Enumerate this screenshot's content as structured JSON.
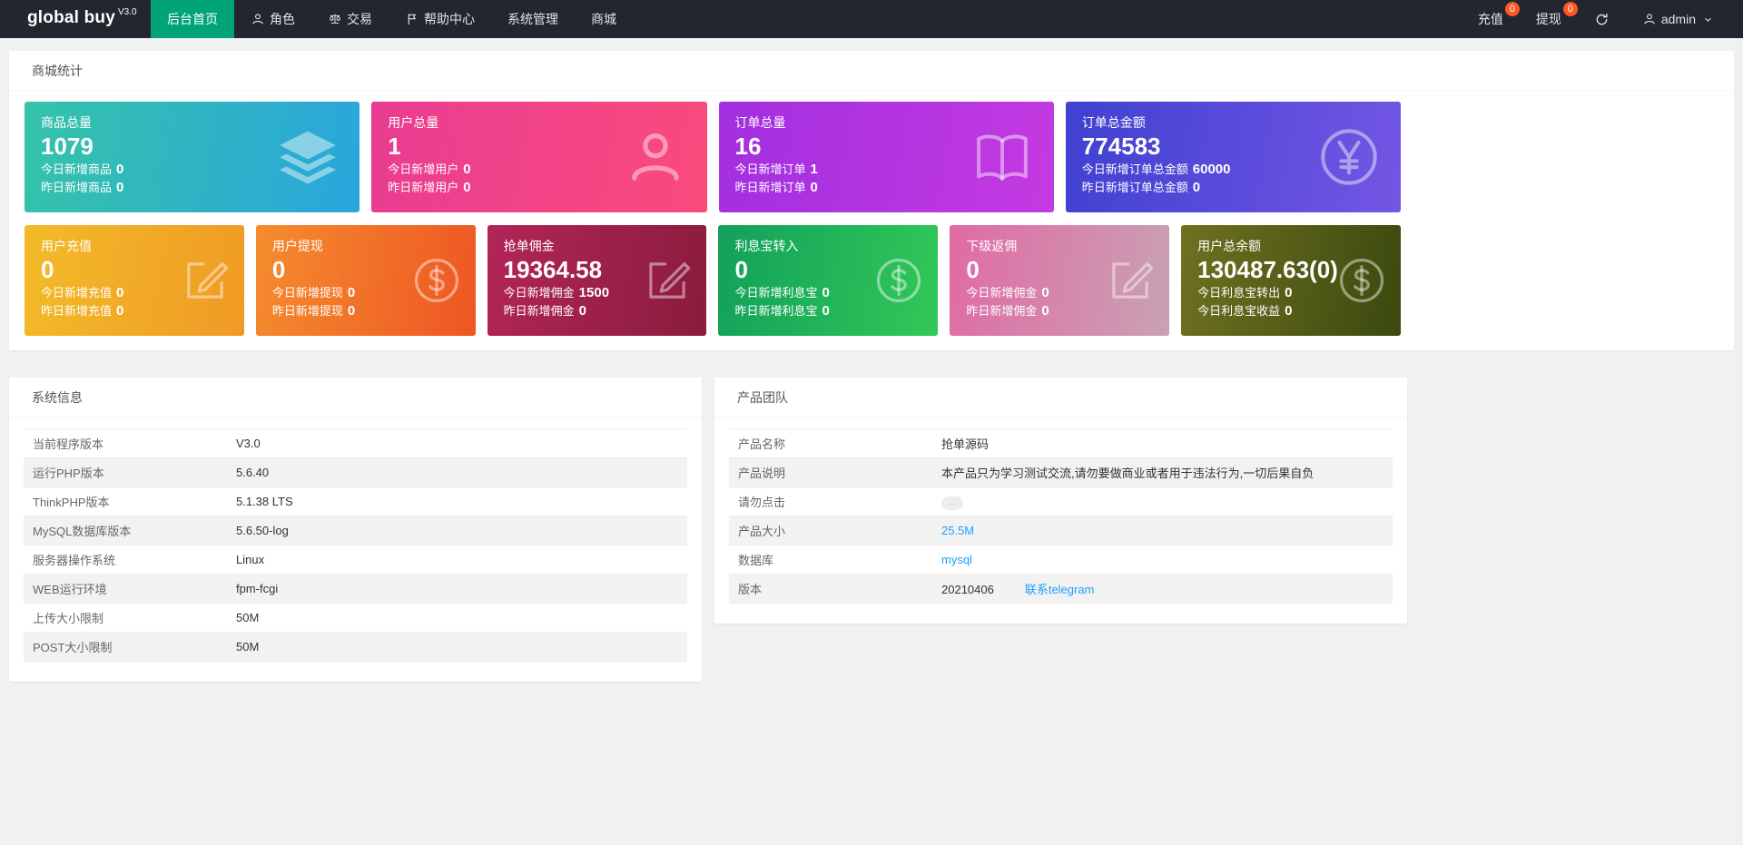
{
  "colors": {
    "navbar_bg": "#23262e",
    "active_nav_green": "#00a478",
    "badge_red": "#ff5722",
    "link_blue": "#1e9fff",
    "page_bg": "#f0f1f2"
  },
  "navbar": {
    "brand": "global buy",
    "brand_version": "V3.0",
    "items": [
      {
        "id": "home",
        "label": "后台首页",
        "active": true
      },
      {
        "id": "roles",
        "label": "角色",
        "icon": "user"
      },
      {
        "id": "trade",
        "label": "交易",
        "icon": "scale"
      },
      {
        "id": "help",
        "label": "帮助中心",
        "icon": "flag"
      },
      {
        "id": "system",
        "label": "系统管理"
      },
      {
        "id": "mall",
        "label": "商城"
      }
    ],
    "right_items": [
      {
        "id": "recharge",
        "label": "充值",
        "badge": "0"
      },
      {
        "id": "withdraw",
        "label": "提现",
        "badge": "0"
      }
    ],
    "user": {
      "label": "admin"
    }
  },
  "stats": {
    "title": "商城统计",
    "row1": [
      {
        "id": "goods-total",
        "title": "商品总量",
        "value": "1079",
        "lines": [
          {
            "label": "今日新增商品",
            "value": "0"
          },
          {
            "label": "昨日新增商品",
            "value": "0"
          }
        ],
        "icon": "layers",
        "gradient": [
          "#35c3a9",
          "#29a6dd"
        ]
      },
      {
        "id": "user-total",
        "title": "用户总量",
        "value": "1",
        "lines": [
          {
            "label": "今日新增用户",
            "value": "0"
          },
          {
            "label": "昨日新增用户",
            "value": "0"
          }
        ],
        "icon": "user",
        "gradient": [
          "#e93c92",
          "#fa4b7c"
        ]
      },
      {
        "id": "order-total",
        "title": "订单总量",
        "value": "16",
        "lines": [
          {
            "label": "今日新增订单",
            "value": "1"
          },
          {
            "label": "昨日新增订单",
            "value": "0"
          }
        ],
        "icon": "book",
        "gradient": [
          "#a22fe0",
          "#c43ae1"
        ]
      },
      {
        "id": "order-amount",
        "title": "订单总金额",
        "value": "774583",
        "lines": [
          {
            "label": "今日新增订单总金额",
            "value": "60000"
          },
          {
            "label": "昨日新增订单总金额",
            "value": "0"
          }
        ],
        "icon": "yen",
        "gradient": [
          "#3f41d1",
          "#7456e4"
        ]
      }
    ],
    "row2": [
      {
        "id": "user-recharge",
        "title": "用户充值",
        "value": "0",
        "lines": [
          {
            "label": "今日新增充值",
            "value": "0"
          },
          {
            "label": "昨日新增充值",
            "value": "0"
          }
        ],
        "icon": "compose",
        "gradient": [
          "#f2bb28",
          "#f09a25"
        ]
      },
      {
        "id": "user-withdraw",
        "title": "用户提现",
        "value": "0",
        "lines": [
          {
            "label": "今日新增提现",
            "value": "0"
          },
          {
            "label": "昨日新增提现",
            "value": "0"
          }
        ],
        "icon": "dollar",
        "gradient": [
          "#f58c2e",
          "#ee5623"
        ]
      },
      {
        "id": "grab-commission",
        "title": "抢单佣金",
        "value": "19364.58",
        "lines": [
          {
            "label": "今日新增佣金",
            "value": "1500"
          },
          {
            "label": "昨日新增佣金",
            "value": "0"
          }
        ],
        "icon": "compose",
        "gradient": [
          "#b22558",
          "#8a1c3d"
        ]
      },
      {
        "id": "interest-in",
        "title": "利息宝转入",
        "value": "0",
        "lines": [
          {
            "label": "今日新增利息宝",
            "value": "0"
          },
          {
            "label": "昨日新增利息宝",
            "value": "0"
          }
        ],
        "icon": "dollar",
        "gradient": [
          "#12a05b",
          "#32c857"
        ]
      },
      {
        "id": "sub-rebate",
        "title": "下级返佣",
        "value": "0",
        "lines": [
          {
            "label": "今日新增佣金",
            "value": "0"
          },
          {
            "label": "昨日新增佣金",
            "value": "0"
          }
        ],
        "icon": "compose",
        "gradient": [
          "#e16aa5",
          "#c8a2b3"
        ]
      },
      {
        "id": "user-balance",
        "title": "用户总余额",
        "value": "130487.63(0)",
        "lines": [
          {
            "label": "今日利息宝转出",
            "value": "0"
          },
          {
            "label": "今日利息宝收益",
            "value": "0"
          }
        ],
        "icon": "dollar",
        "gradient": [
          "#6f7120",
          "#3b490f"
        ]
      }
    ]
  },
  "system_info": {
    "title": "系统信息",
    "rows": [
      {
        "label": "当前程序版本",
        "value": "V3.0"
      },
      {
        "label": "运行PHP版本",
        "value": "5.6.40"
      },
      {
        "label": "ThinkPHP版本",
        "value": "5.1.38 LTS"
      },
      {
        "label": "MySQL数据库版本",
        "value": "5.6.50-log"
      },
      {
        "label": "服务器操作系统",
        "value": "Linux"
      },
      {
        "label": "WEB运行环境",
        "value": "fpm-fcgi"
      },
      {
        "label": "上传大小限制",
        "value": "50M"
      },
      {
        "label": "POST大小限制",
        "value": "50M"
      }
    ]
  },
  "product_team": {
    "title": "产品团队",
    "rows": [
      {
        "label": "产品名称",
        "value": "抢单源码",
        "type": "text"
      },
      {
        "label": "产品说明",
        "value": "本产品只为学习测试交流,请勿要做商业或者用于违法行为,一切后果自负",
        "type": "text"
      },
      {
        "label": "请勿点击",
        "value": "...",
        "type": "badge"
      },
      {
        "label": "产品大小",
        "value": "25.5M",
        "type": "link"
      },
      {
        "label": "数据库",
        "value": "mysql",
        "type": "link"
      },
      {
        "label": "版本",
        "value": "20210406",
        "extra_link": "联系telegram",
        "type": "text"
      }
    ]
  }
}
